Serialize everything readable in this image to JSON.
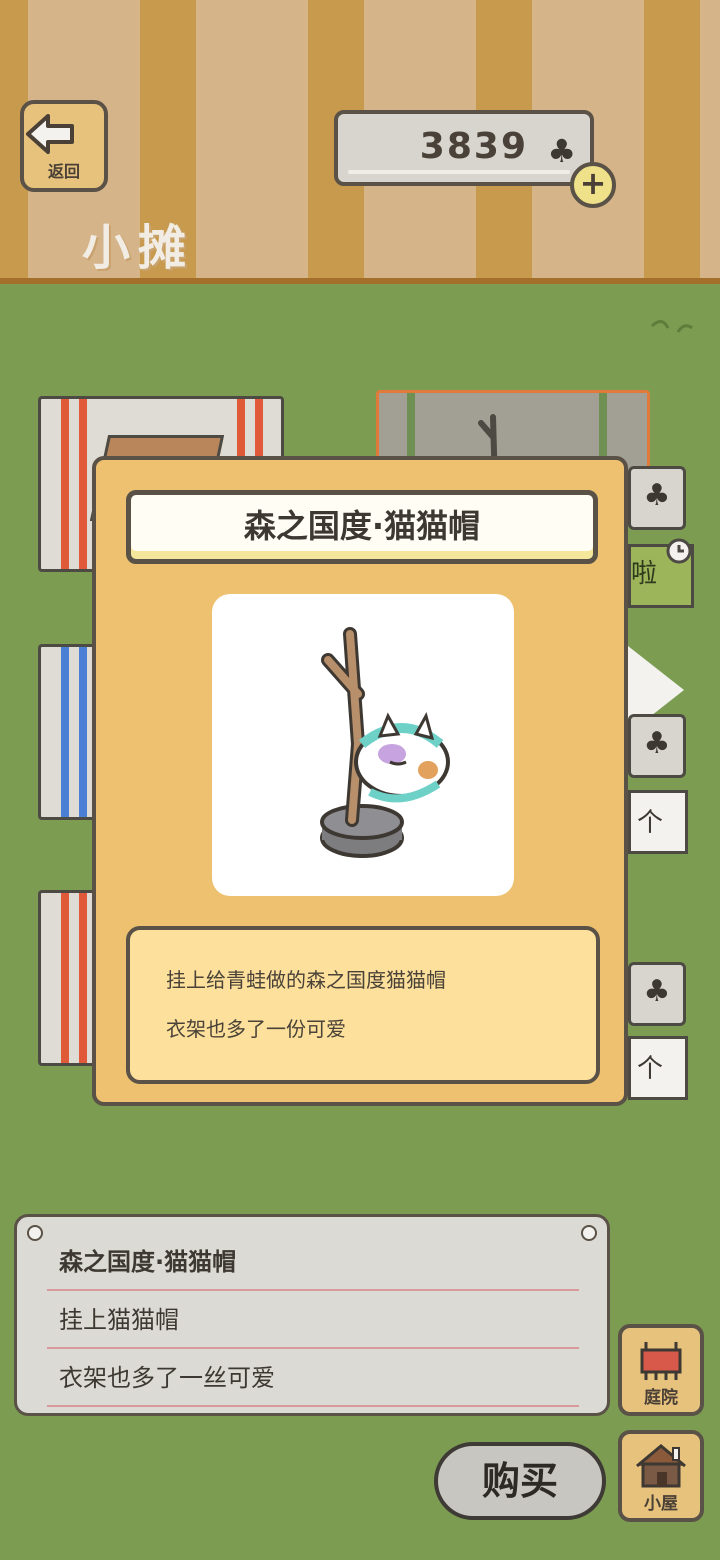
{
  "header": {
    "back_label": "返回",
    "title": "小摊"
  },
  "currency": {
    "amount": "3839",
    "icon": "clover-icon",
    "add_label": "+"
  },
  "shelf": {
    "sold_text": "啦",
    "count_suffix": "个"
  },
  "modal": {
    "title": "森之国度·猫猫帽",
    "image": "coat-rack-cat-hat-icon",
    "desc_lines": [
      "挂上给青蛙做的森之国度猫猫帽",
      "衣架也多了一份可爱"
    ]
  },
  "info_panel": {
    "lines": [
      "森之国度·猫猫帽",
      "挂上猫猫帽",
      "衣架也多了一丝可爱"
    ]
  },
  "actions": {
    "buy_label": "购买",
    "yard_label": "庭院",
    "house_label": "小屋"
  },
  "colors": {
    "grass": "#7c9c52",
    "modal_bg": "#edc16f",
    "desc_bg": "#fde09c",
    "outline": "#5a5247"
  }
}
